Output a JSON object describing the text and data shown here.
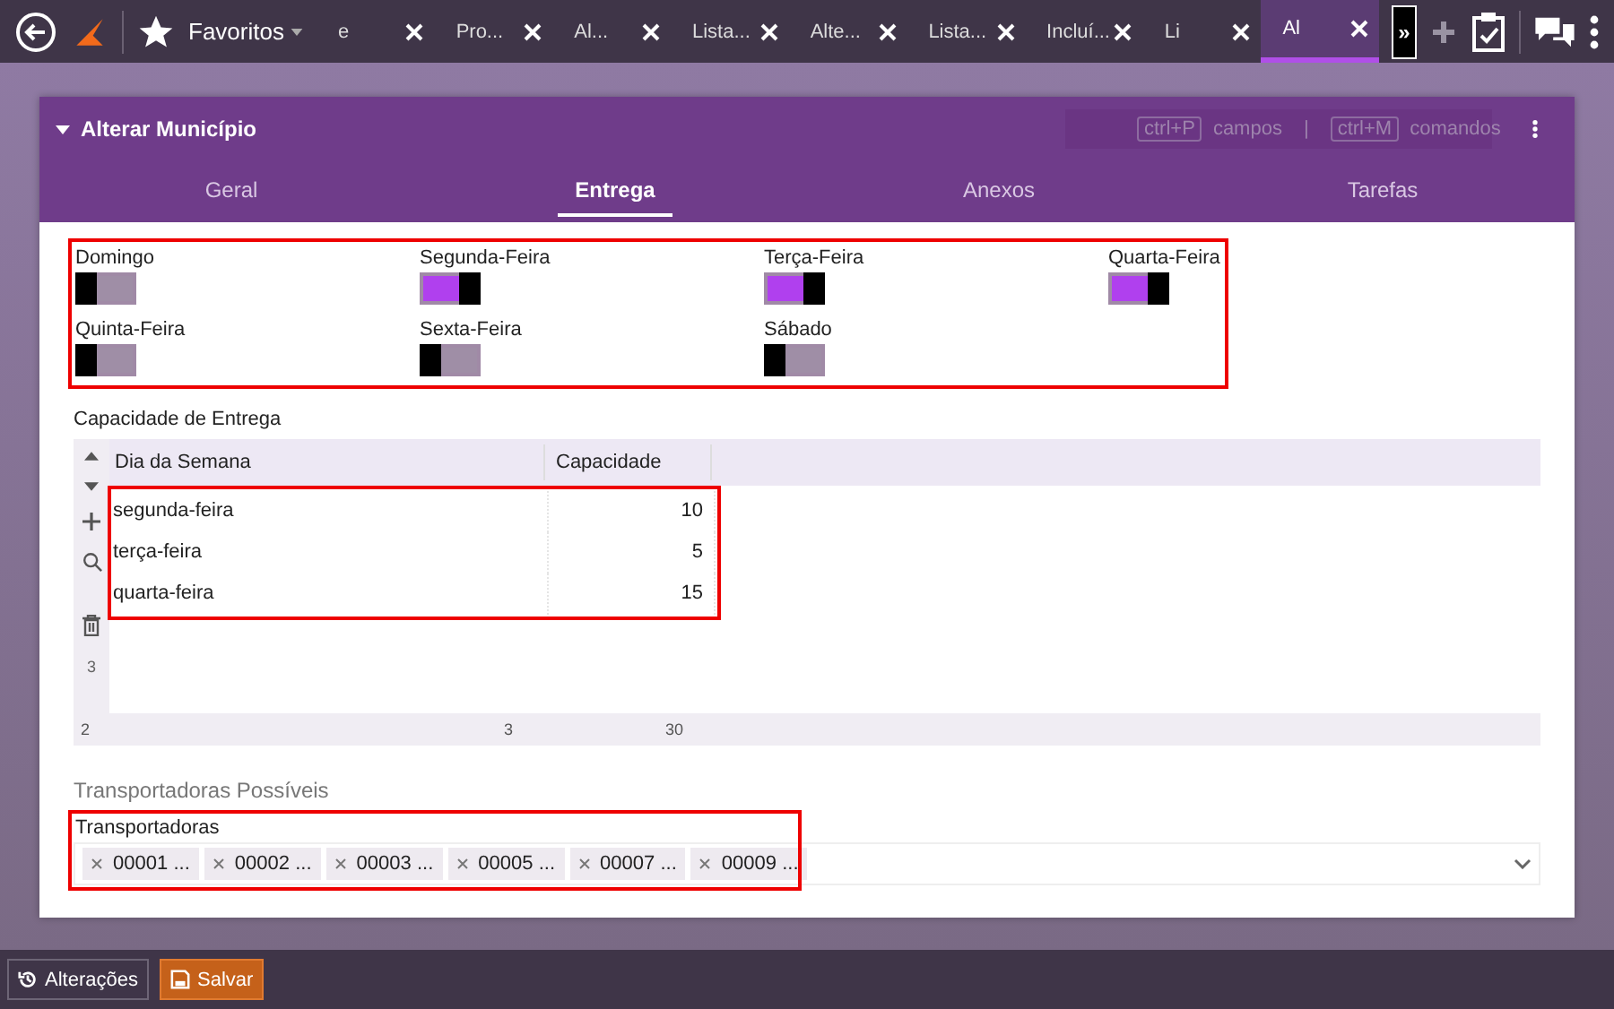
{
  "top_bar": {
    "favorites": "Favoritos",
    "tabs": [
      {
        "label": "e",
        "selected": false
      },
      {
        "label": "Pro...",
        "selected": false
      },
      {
        "label": "Al...",
        "selected": false
      },
      {
        "label": "Lista...",
        "selected": false
      },
      {
        "label": "Alte...",
        "selected": false
      },
      {
        "label": "Lista...",
        "selected": false
      },
      {
        "label": "Incluí...",
        "selected": false
      },
      {
        "label": "Li",
        "selected": false
      },
      {
        "label": "Al",
        "selected": true
      }
    ],
    "overflow": "»"
  },
  "form": {
    "title": "Alterar Município",
    "shortcuts": [
      {
        "key": "ctrl+P",
        "label": "campos"
      },
      {
        "key": "ctrl+M",
        "label": "comandos"
      }
    ],
    "separator": "|",
    "tabs": [
      {
        "label": "Geral",
        "selected": false
      },
      {
        "label": "Entrega",
        "selected": true
      },
      {
        "label": "Anexos",
        "selected": false
      },
      {
        "label": "Tarefas",
        "selected": false
      }
    ]
  },
  "days": [
    {
      "label": "Domingo",
      "on": false
    },
    {
      "label": "Segunda-Feira",
      "on": true
    },
    {
      "label": "Terça-Feira",
      "on": true
    },
    {
      "label": "Quarta-Feira",
      "on": true
    },
    {
      "label": "Quinta-Feira",
      "on": false
    },
    {
      "label": "Sexta-Feira",
      "on": false
    },
    {
      "label": "Sábado",
      "on": false
    }
  ],
  "capacity": {
    "title": "Capacidade de Entrega",
    "columns": [
      "Dia da Semana",
      "Capacidade"
    ],
    "rows": [
      {
        "day": "segunda-feira",
        "capacity": "10"
      },
      {
        "day": "terça-feira",
        "capacity": "5"
      },
      {
        "day": "quarta-feira",
        "capacity": "15"
      }
    ],
    "toolbar_count": "3",
    "footer": {
      "page": "2",
      "count": "3",
      "total": "30"
    }
  },
  "carriers": {
    "section": "Transportadoras Possíveis",
    "label": "Transportadoras",
    "chips": [
      "00001 ...",
      "00002 ...",
      "00003 ...",
      "00005 ...",
      "00007 ...",
      "00009 ..."
    ]
  },
  "bottom_bar": {
    "buttons": [
      {
        "label": "Alterações",
        "kind": "history"
      },
      {
        "label": "Salvar",
        "kind": "save"
      }
    ]
  }
}
